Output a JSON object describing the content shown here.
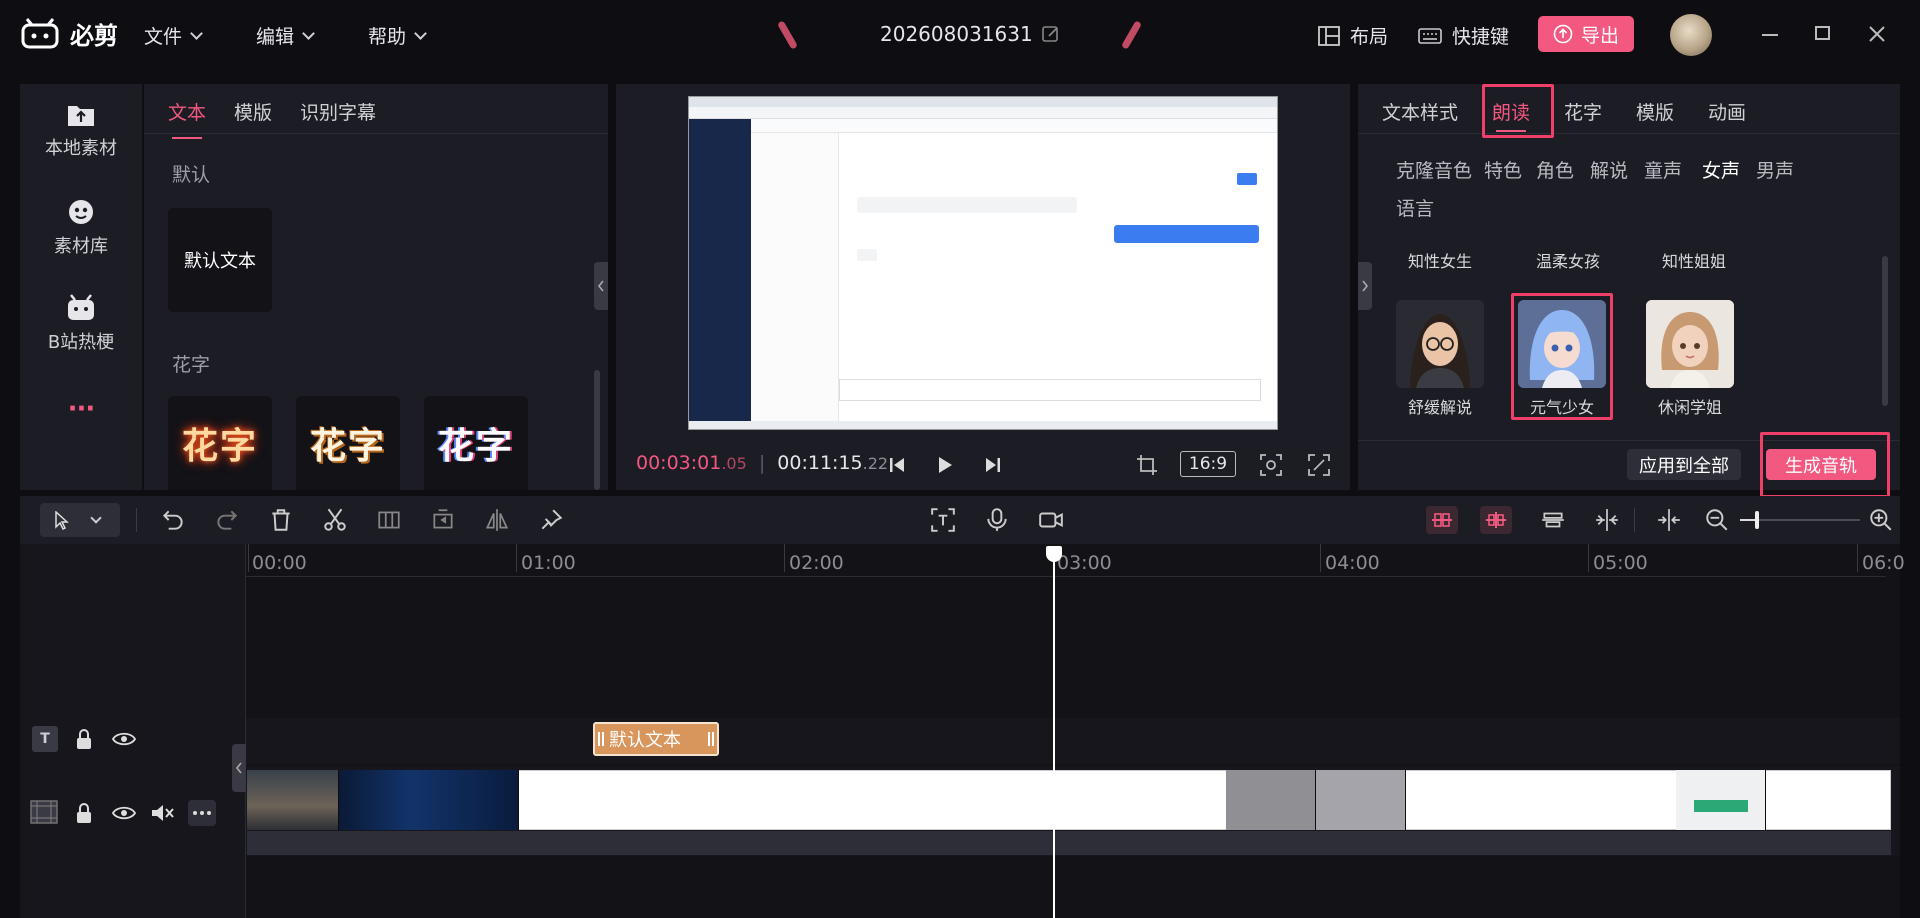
{
  "app": {
    "logo_text": "必剪",
    "menus": [
      "文件",
      "编辑",
      "帮助"
    ],
    "project_name": "202608031631",
    "layout_label": "布局",
    "shortcut_label": "快捷键",
    "export_label": "导出"
  },
  "left_icons": [
    {
      "icon": "folder-upload-icon",
      "label": "本地素材"
    },
    {
      "icon": "material-library-icon",
      "label": "素材库"
    },
    {
      "icon": "bilibili-tv-icon",
      "label": "B站热梗"
    },
    {
      "icon": "more-dots-icon",
      "label": "···"
    }
  ],
  "left_panel": {
    "tabs": [
      "文本",
      "模版",
      "识别字幕"
    ],
    "active_tab": "文本",
    "default_section": "默认",
    "default_card": "默认文本",
    "huazi_section": "花字",
    "huazi_cards": [
      "花字",
      "花字",
      "花字"
    ]
  },
  "preview": {
    "time_current_main": "00:03:01",
    "time_current_frac": ".05",
    "time_total_main": "00:11:15",
    "time_total_frac": ".22",
    "ratio": "16:9"
  },
  "right_panel": {
    "tabs": [
      "文本样式",
      "朗读",
      "花字",
      "模版",
      "动画"
    ],
    "active_tab": "朗读",
    "voice_categories": [
      "克隆音色",
      "特色",
      "角色",
      "解说",
      "童声",
      "女声",
      "男声",
      "语言"
    ],
    "active_category": "女声",
    "voices_row1": [
      "知性女生",
      "温柔女孩",
      "知性姐姐"
    ],
    "voices_row2": [
      "舒缓解说",
      "元气少女",
      "休闲学姐"
    ],
    "selected_voice": "元气少女",
    "apply_all_label": "应用到全部",
    "generate_label": "生成音轨"
  },
  "timeline": {
    "ruler": [
      "00:00",
      "01:00",
      "02:00",
      "03:00",
      "04:00",
      "05:00",
      "06:0"
    ],
    "text_clip_label": "默认文本",
    "playhead_time": "03:00"
  },
  "colors": {
    "accent": "#f25880",
    "highlight": "#f0406a",
    "bg": "#0d0d12",
    "panel": "#1c1c24"
  }
}
